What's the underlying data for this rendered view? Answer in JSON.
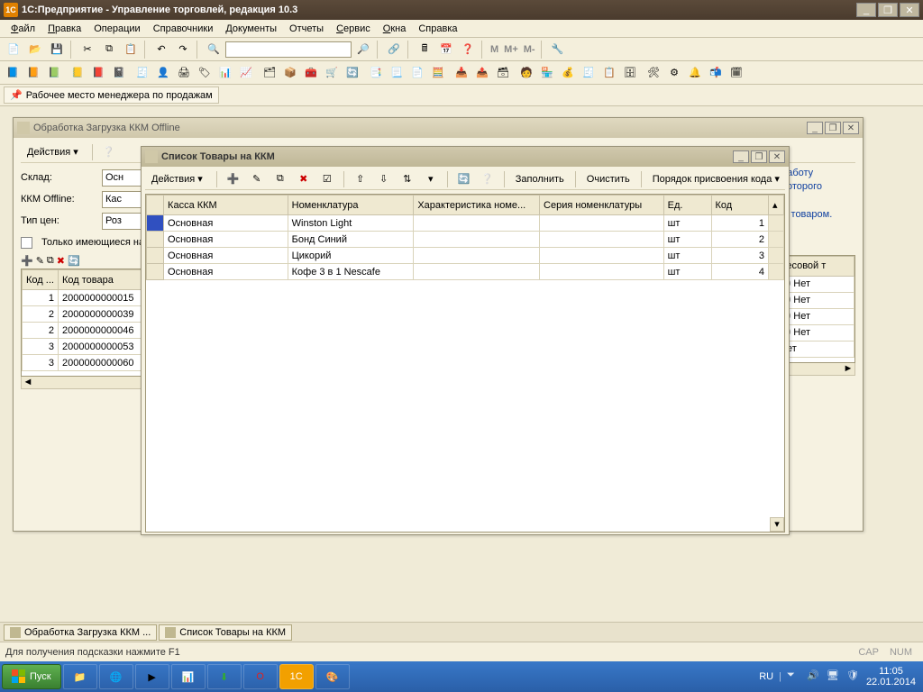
{
  "app": {
    "title": "1С:Предприятие - Управление торговлей, редакция 10.3"
  },
  "menu": {
    "file": "Файл",
    "edit": "Правка",
    "ops": "Операции",
    "refs": "Справочники",
    "docs": "Документы",
    "reps": "Отчеты",
    "serv": "Сервис",
    "wins": "Окна",
    "help": "Справка"
  },
  "linkbar": {
    "sales_mgr": "Рабочее место менеджера по продажам"
  },
  "bgwin": {
    "title": "Обработка  Загрузка ККМ Offline",
    "actions": "Действия",
    "labels": {
      "warehouse": "Склад:",
      "kkm": "ККМ Offline:",
      "pricetype": "Тип цен:",
      "only_avail": "Только имеющиеся на"
    },
    "vals": {
      "warehouse": "Осн",
      "kkm": "Кас",
      "pricetype": "Роз"
    },
    "hint1": "т работу",
    "hint2": "я которого",
    "hint3": "ым товаром.",
    "cols": {
      "code": "Код ...",
      "prodcode": "Код товара",
      "weight": "Весовой т"
    },
    "rows": [
      {
        "n": "1",
        "code": "2000000000015",
        "w": "Нет",
        "tail": "00"
      },
      {
        "n": "2",
        "code": "2000000000039",
        "w": "Нет",
        "tail": "00"
      },
      {
        "n": "2",
        "code": "2000000000046",
        "w": "Нет",
        "tail": "00"
      },
      {
        "n": "3",
        "code": "2000000000053",
        "w": "Нет",
        "tail": "00"
      },
      {
        "n": "3",
        "code": "2000000000060",
        "w": "Нет",
        "tail": ""
      }
    ]
  },
  "fgwin": {
    "title": "Список Товары на ККМ",
    "toolbar": {
      "actions": "Действия",
      "fill": "Заполнить",
      "clear": "Очистить",
      "code_order": "Порядок присвоения кода"
    },
    "cols": {
      "kassa": "Касса ККМ",
      "nomen": "Номенклатура",
      "char": "Характеристика номе...",
      "series": "Серия номенклатуры",
      "unit": "Ед.",
      "code": "Код"
    },
    "rows": [
      {
        "kassa": "Основная",
        "nomen": "Winston Light",
        "char": "",
        "series": "",
        "unit": "шт",
        "code": "1"
      },
      {
        "kassa": "Основная",
        "nomen": "Бонд Синий",
        "char": "",
        "series": "",
        "unit": "шт",
        "code": "2"
      },
      {
        "kassa": "Основная",
        "nomen": "Цикорий",
        "char": "",
        "series": "",
        "unit": "шт",
        "code": "3"
      },
      {
        "kassa": "Основная",
        "nomen": "Кофе 3 в 1 Nescafe",
        "char": "",
        "series": "",
        "unit": "шт",
        "code": "4"
      }
    ]
  },
  "tabs": {
    "t1": "Обработка  Загрузка ККМ ...",
    "t2": "Список Товары на ККМ"
  },
  "hint": "Для получения подсказки нажмите F1",
  "ind": {
    "cap": "CAP",
    "num": "NUM"
  },
  "taskbar": {
    "start": "Пуск",
    "lang": "RU",
    "time": "11:05",
    "date": "22.01.2014"
  }
}
